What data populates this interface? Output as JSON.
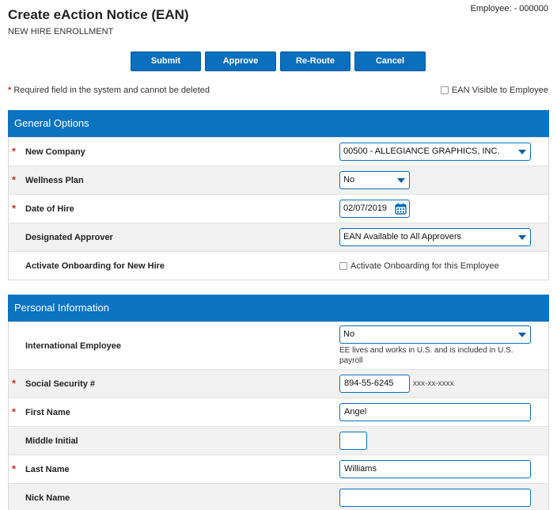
{
  "header": {
    "title": "Create eAction Notice (EAN)",
    "subtitle": "NEW HIRE ENROLLMENT",
    "employee": "Employee: - 000000"
  },
  "actions": {
    "submit": "Submit",
    "approve": "Approve",
    "reroute": "Re-Route",
    "cancel": "Cancel"
  },
  "required_note": "Required field in the system and cannot be deleted",
  "ean_visible_label": "EAN Visible to Employee",
  "colors": {
    "accent": "#0a73c2",
    "required": "#c0392b"
  },
  "general": {
    "title": "General Options",
    "new_company_label": "New Company",
    "new_company_value": "00500 - ALLEGIANCE GRAPHICS, INC.",
    "wellness_label": "Wellness Plan",
    "wellness_value": "No",
    "hire_label": "Date of Hire",
    "hire_value": "02/07/2019",
    "approver_label": "Designated Approver",
    "approver_value": "EAN Available to All Approvers",
    "onboarding_label": "Activate Onboarding for New Hire",
    "onboarding_checkbox_label": "Activate Onboarding for this Employee"
  },
  "personal": {
    "title": "Personal Information",
    "intl_label": "International Employee",
    "intl_value": "No",
    "intl_help": "EE lives and works in U.S. and is included in U.S. payroll",
    "ssn_label": "Social Security #",
    "ssn_value": "894-55-6245",
    "ssn_hint": "xxx-xx-xxxx",
    "first_label": "First Name",
    "first_value": "Angel",
    "middle_label": "Middle Initial",
    "middle_value": "",
    "last_label": "Last Name",
    "last_value": "Williams",
    "nick_label": "Nick Name",
    "nick_value": ""
  }
}
